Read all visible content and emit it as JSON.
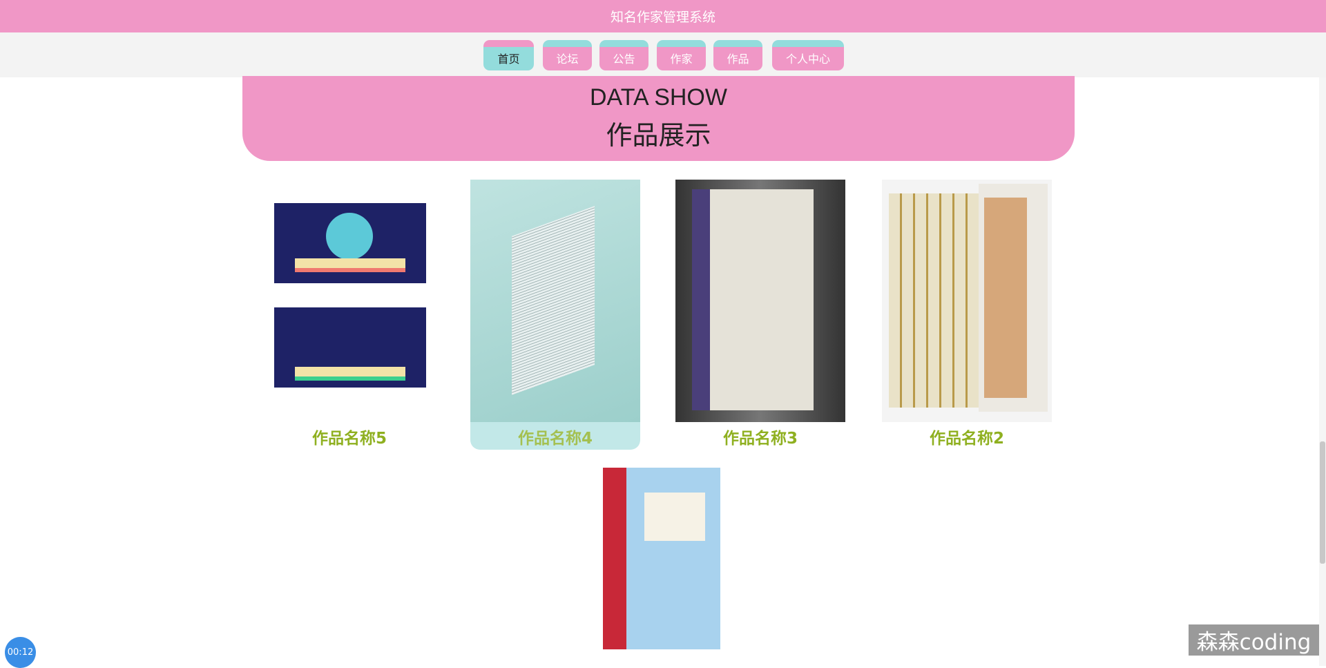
{
  "header": {
    "title": "知名作家管理系统"
  },
  "nav": [
    {
      "label": "首页",
      "active": true
    },
    {
      "label": "论坛"
    },
    {
      "label": "公告"
    },
    {
      "label": "作家"
    },
    {
      "label": "作品"
    },
    {
      "label": "个人中心"
    }
  ],
  "banner": {
    "en": "DATA SHOW",
    "cn": "作品展示"
  },
  "works": [
    {
      "title": "作品名称5"
    },
    {
      "title": "作品名称4"
    },
    {
      "title": "作品名称3"
    },
    {
      "title": "作品名称2"
    }
  ],
  "timer": "00:12",
  "watermark": "森森coding",
  "colors": {
    "pink": "#f097c6",
    "teal": "#93dcdc",
    "title_green": "#8fb020"
  }
}
